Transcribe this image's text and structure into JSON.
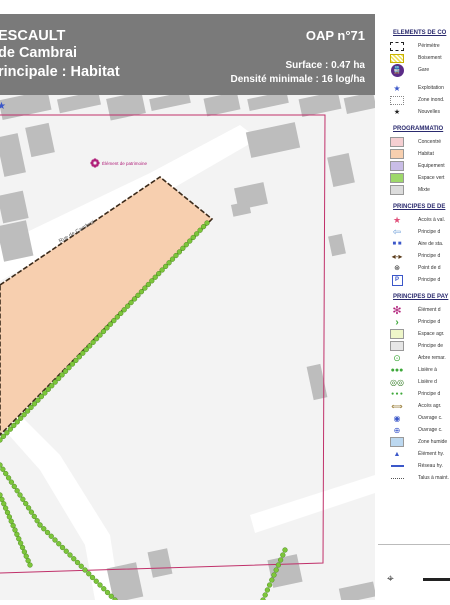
{
  "header": {
    "title_line1": "ESCAULT",
    "title_line2": "de Cambrai",
    "title_line3": "rincipale : Habitat",
    "oap": "OAP n°71",
    "surface": "Surface : 0.47 ha",
    "density": "Densité minimale : 16 log/ha"
  },
  "map": {
    "street_label": "Rue de Cambrai",
    "heritage_label": "Élément de patrimoine",
    "colors": {
      "habitat_zone": "#f7cfaf",
      "tree_row": "#7cc63a",
      "perimeter": "#c0306a",
      "buildings": "#bdbdbd",
      "heritage": "#b0207a"
    }
  },
  "legend": {
    "sections": [
      {
        "title": "ELEMENTS DE CO",
        "items": [
          {
            "label": "Périmètre",
            "symbol": "dashed-frame"
          },
          {
            "label": "Boisement",
            "symbol": "yellow-hatch"
          },
          {
            "label": "Gare",
            "symbol": "train-icon"
          },
          {
            "label": "Exploitation",
            "symbol": "blue-star"
          },
          {
            "label": "Zone inond.",
            "symbol": "grey-box"
          },
          {
            "label": "Nouvelles",
            "symbol": "black-star"
          }
        ]
      },
      {
        "title": "PROGRAMMATIO",
        "items": [
          {
            "label": "Concentré",
            "symbol": "swatch-pink"
          },
          {
            "label": "Habitat",
            "symbol": "swatch-orange"
          },
          {
            "label": "Equipement",
            "symbol": "swatch-purple"
          },
          {
            "label": "Espace vert",
            "symbol": "swatch-green"
          },
          {
            "label": "Mixte",
            "symbol": "swatch-grey"
          }
        ]
      },
      {
        "title": "PRINCIPES DE DE",
        "items": [
          {
            "label": "Accès à val.",
            "symbol": "red-star"
          },
          {
            "label": "Principe d",
            "symbol": "blue-arrow"
          },
          {
            "label": "Aire de sta.",
            "symbol": "blue-dots"
          },
          {
            "label": "Principe d",
            "symbol": "double-arrow"
          },
          {
            "label": "Point de d",
            "symbol": "dot-circle"
          },
          {
            "label": "Principe d",
            "symbol": "parking-icon"
          }
        ]
      },
      {
        "title": "PRINCIPES DE PAY",
        "items": [
          {
            "label": "Élément d",
            "symbol": "purple-flower"
          },
          {
            "label": "Principe d",
            "symbol": "green-chevron"
          },
          {
            "label": "Espace agr.",
            "symbol": "swatch-lightgreen"
          },
          {
            "label": "Principe de",
            "symbol": "swatch-lightgrey"
          },
          {
            "label": "Arbre remar.",
            "symbol": "green-ring"
          },
          {
            "label": "Lisière à",
            "symbol": "green-dot-line"
          },
          {
            "label": "Lisière d",
            "symbol": "green-big-rings"
          },
          {
            "label": "Principe d",
            "symbol": "green-dots"
          },
          {
            "label": "Accès agr.",
            "symbol": "brown-arrow"
          },
          {
            "label": "Ouvrage c.",
            "symbol": "blue-ring"
          },
          {
            "label": "Ouvrage c.",
            "symbol": "blue-triangle-ring"
          },
          {
            "label": "Zone humide",
            "symbol": "swatch-lightblue"
          },
          {
            "label": "Élément hy.",
            "symbol": "blue-triangle"
          },
          {
            "label": "Réseau hy.",
            "symbol": "blue-line"
          },
          {
            "label": "Talus à maint.",
            "symbol": "dotted-line"
          }
        ]
      }
    ],
    "colors": {
      "pink": "#f5cfd2",
      "orange": "#f7cfaf",
      "purple": "#c9bde6",
      "green": "#9ed86a",
      "grey": "#dcdcdc",
      "lightgreen": "#eef6c9",
      "lightgrey": "#e6e6e6",
      "lightblue": "#bcd8f0"
    }
  }
}
